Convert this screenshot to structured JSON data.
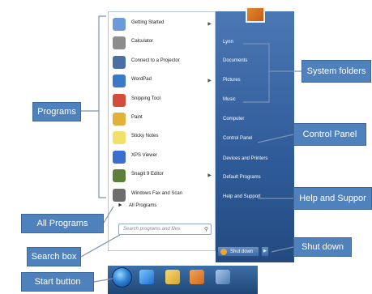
{
  "start_menu": {
    "programs": [
      {
        "label": "Getting Started",
        "icon": "getting-started-icon",
        "color": "#6a9bd8",
        "has_submenu": true
      },
      {
        "label": "Calculator",
        "icon": "calculator-icon",
        "color": "#8c8c8c",
        "has_submenu": false
      },
      {
        "label": "Connect to a Projector",
        "icon": "projector-icon",
        "color": "#4a6fa5",
        "has_submenu": false
      },
      {
        "label": "WordPad",
        "icon": "wordpad-icon",
        "color": "#3a78c9",
        "has_submenu": true
      },
      {
        "label": "Snipping Tool",
        "icon": "scissors-icon",
        "color": "#d44c3a",
        "has_submenu": false
      },
      {
        "label": "Paint",
        "icon": "paint-icon",
        "color": "#e0b23a",
        "has_submenu": false
      },
      {
        "label": "Sticky Notes",
        "icon": "sticky-notes-icon",
        "color": "#f2e06b",
        "has_submenu": false
      },
      {
        "label": "XPS Viewer",
        "icon": "xps-viewer-icon",
        "color": "#3a6fcf",
        "has_submenu": false
      },
      {
        "label": "SnagIt 9 Editor",
        "icon": "snagit-icon",
        "color": "#5c7f3a",
        "has_submenu": true
      },
      {
        "label": "Windows Fax and Scan",
        "icon": "fax-scan-icon",
        "color": "#6d6d6d",
        "has_submenu": false
      }
    ],
    "all_programs_label": "All Programs",
    "search_placeholder": "Search programs and files",
    "right_items": [
      {
        "label": "Lynn"
      },
      {
        "label": "Documents"
      },
      {
        "label": "Pictures"
      },
      {
        "label": "Music"
      },
      {
        "label": "Computer"
      },
      {
        "label": "Control Panel"
      },
      {
        "label": "Devices and Printers"
      },
      {
        "label": "Default Programs"
      },
      {
        "label": "Help and Support"
      }
    ],
    "shutdown_label": "Shut down"
  },
  "taskbar": {
    "icons": [
      "start-orb-icon",
      "internet-explorer-icon",
      "file-explorer-icon",
      "media-player-icon",
      "program-icon"
    ]
  },
  "callouts": {
    "programs": "Programs",
    "system_folders": "System folders",
    "control_panel": "Control Panel",
    "help_support": "Help and Suppor",
    "all_programs": "All Programs",
    "search_box": "Search box",
    "shut_down": "Shut down",
    "start_button": "Start button"
  },
  "colors": {
    "callout": "#4f81bd",
    "menu_right": "#2e5b98",
    "line": "#7a93b5"
  }
}
